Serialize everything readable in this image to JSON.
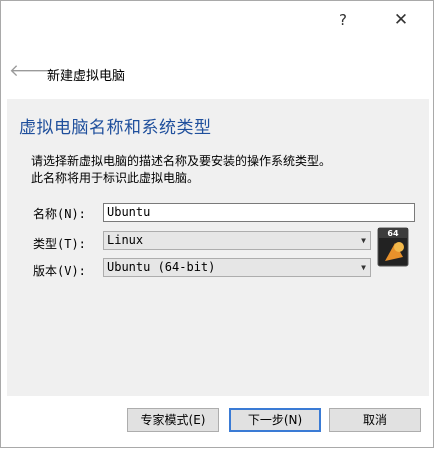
{
  "titlebar": {
    "help_label": "?",
    "close_label": "✕"
  },
  "wizard": {
    "back_icon": "arrow-left-icon",
    "title": "新建虚拟电脑"
  },
  "page": {
    "heading": "虚拟电脑名称和系统类型",
    "description_line1": "请选择新虚拟电脑的描述名称及要安装的操作系统类型。",
    "description_line2": "此名称将用于标识此虚拟电脑。"
  },
  "form": {
    "name_label": "名称(N):",
    "name_value": "Ubuntu",
    "type_label": "类型(T):",
    "type_value": "Linux",
    "version_label": "版本(V):",
    "version_value": "Ubuntu (64-bit)"
  },
  "os_icon": {
    "badge": "64",
    "name": "ubuntu-os-icon"
  },
  "buttons": {
    "expert_mode": "专家模式(E)",
    "next": "下一步(N)",
    "cancel": "取消"
  },
  "colors": {
    "heading": "#1f4f9c",
    "default_button_border": "#3a7bd5"
  }
}
